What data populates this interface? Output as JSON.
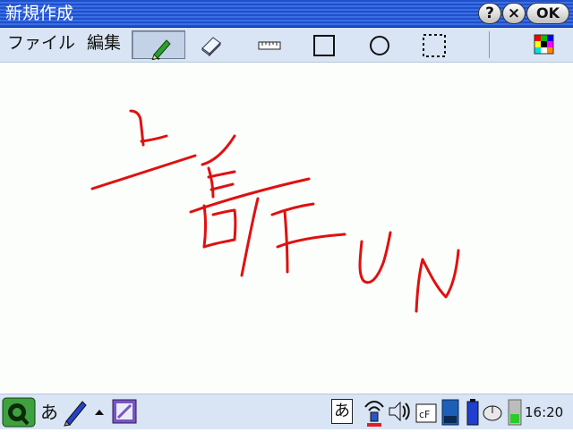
{
  "window": {
    "title": "新規作成",
    "help_label": "?",
    "close_label": "×",
    "ok_label": "OK"
  },
  "menu": {
    "file_label": "ファイル",
    "edit_label": "編集"
  },
  "toolbar": {
    "tools": [
      "pen-icon",
      "eraser-icon",
      "ruler-icon",
      "rectangle-icon",
      "circle-icon",
      "selection-icon",
      "color-palette-icon"
    ],
    "active_tool": "pen-icon"
  },
  "canvas": {
    "stroke_color": "#e01010",
    "handwritten_text": "上野FUN"
  },
  "taskbar": {
    "ime_mode": "あ",
    "ime_indicator": "あ",
    "clock": "16:20",
    "tray_icons": [
      "qtopia-launcher-icon",
      "pen-input-icon",
      "up-arrow-icon",
      "app-icon",
      "ime-icon",
      "wireless-icon",
      "volume-icon",
      "cf-card-icon",
      "sd-card-icon",
      "battery-icon",
      "mouse-icon",
      "signal-icon"
    ]
  }
}
